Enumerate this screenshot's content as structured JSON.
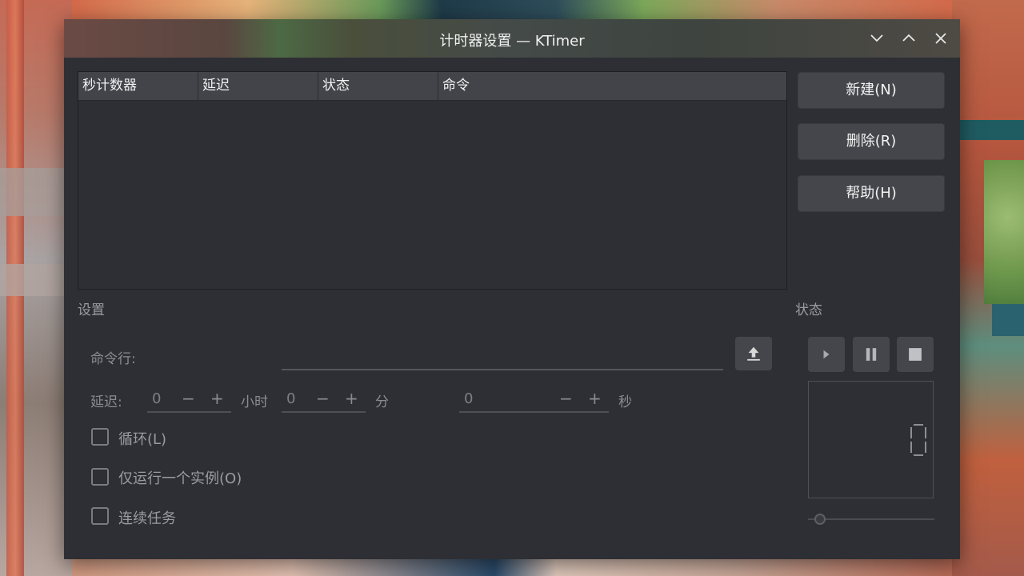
{
  "window": {
    "title": "计时器设置 — KTimer"
  },
  "table": {
    "columns": [
      "秒计数器",
      "延迟",
      "状态",
      "命令"
    ],
    "rows": []
  },
  "buttons": {
    "new": "新建(N)",
    "delete": "删除(R)",
    "help": "帮助(H)"
  },
  "settings": {
    "label": "设置",
    "command_label": "命令行:",
    "command_value": "",
    "delay_label": "延迟:",
    "hours_value": "0",
    "hours_unit": "小时",
    "minutes_value": "0",
    "minutes_unit": "分",
    "seconds_value": "0",
    "seconds_unit": "秒",
    "minus": "−",
    "plus": "+",
    "loop": "循环(L)",
    "single_instance": "仅运行一个实例(O)",
    "consecutive": "连续任务"
  },
  "status": {
    "label": "状态",
    "lcd_value": "0",
    "progress": 0
  },
  "colors": {
    "window_bg": "#2e2f34",
    "button_bg": "#45464c",
    "header_bg": "#43444a"
  }
}
